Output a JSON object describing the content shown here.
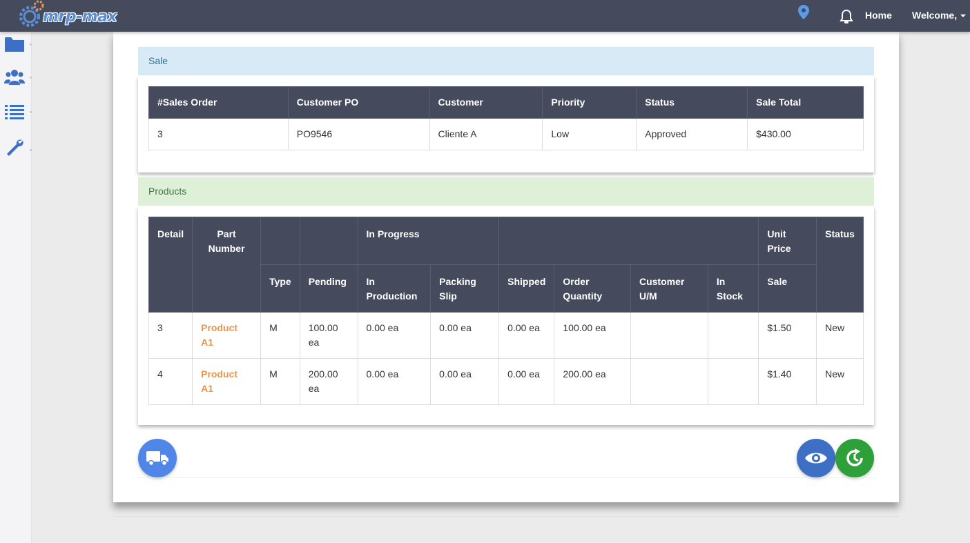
{
  "app": {
    "logo_text": "mrp-max"
  },
  "nav": {
    "home_label": "Home",
    "welcome_label": "Welcome,"
  },
  "sale": {
    "heading": "Sale",
    "columns": [
      "#Sales Order",
      "Customer PO",
      "Customer",
      "Priority",
      "Status",
      "Sale Total"
    ],
    "row": {
      "sales_order": "3",
      "customer_po": "PO9546",
      "customer": "Cliente A",
      "priority": "Low",
      "status": "Approved",
      "sale_total": "$430.00"
    }
  },
  "products": {
    "heading": "Products",
    "headers": {
      "detail": "Detail",
      "part_number": "Part Number",
      "in_progress": "In Progress",
      "unit_price": "Unit Price",
      "status": "Status",
      "type": "Type",
      "pending": "Pending",
      "in_production": "In Production",
      "packing_slip": "Packing Slip",
      "shipped": "Shipped",
      "order_quantity": "Order Quantity",
      "customer_um": "Customer U/M",
      "in_stock": "In Stock",
      "sale": "Sale"
    },
    "rows": [
      {
        "detail": "3",
        "part_number": "Product A1",
        "type": "M",
        "pending": "100.00 ea",
        "in_production": "0.00 ea",
        "packing_slip": "0.00 ea",
        "shipped": "0.00 ea",
        "order_quantity": "100.00 ea",
        "customer_um": "",
        "in_stock": "",
        "sale": "$1.50",
        "status": "New"
      },
      {
        "detail": "4",
        "part_number": "Product A1",
        "type": "M",
        "pending": "200.00 ea",
        "in_production": "0.00 ea",
        "packing_slip": "0.00 ea",
        "shipped": "0.00 ea",
        "order_quantity": "200.00 ea",
        "customer_um": "",
        "in_stock": "",
        "sale": "$1.40",
        "status": "New"
      }
    ]
  },
  "icons": {
    "sidebar": [
      "folder-icon",
      "users-icon",
      "list-icon",
      "wrench-icon"
    ],
    "navbar": [
      "map-pin-icon",
      "bell-icon",
      "caret-down-icon"
    ],
    "actions": [
      "truck-icon",
      "eye-icon",
      "refresh-icon"
    ]
  },
  "colors": {
    "navbar": "#454a5c",
    "sale_heading_bg": "#d9eaf7",
    "products_heading_bg": "#dff0d8",
    "part_link": "#e8964a",
    "truck_button": "#4f86e8",
    "eye_button": "#3d6fc4",
    "refresh_button": "#2ea03a"
  }
}
